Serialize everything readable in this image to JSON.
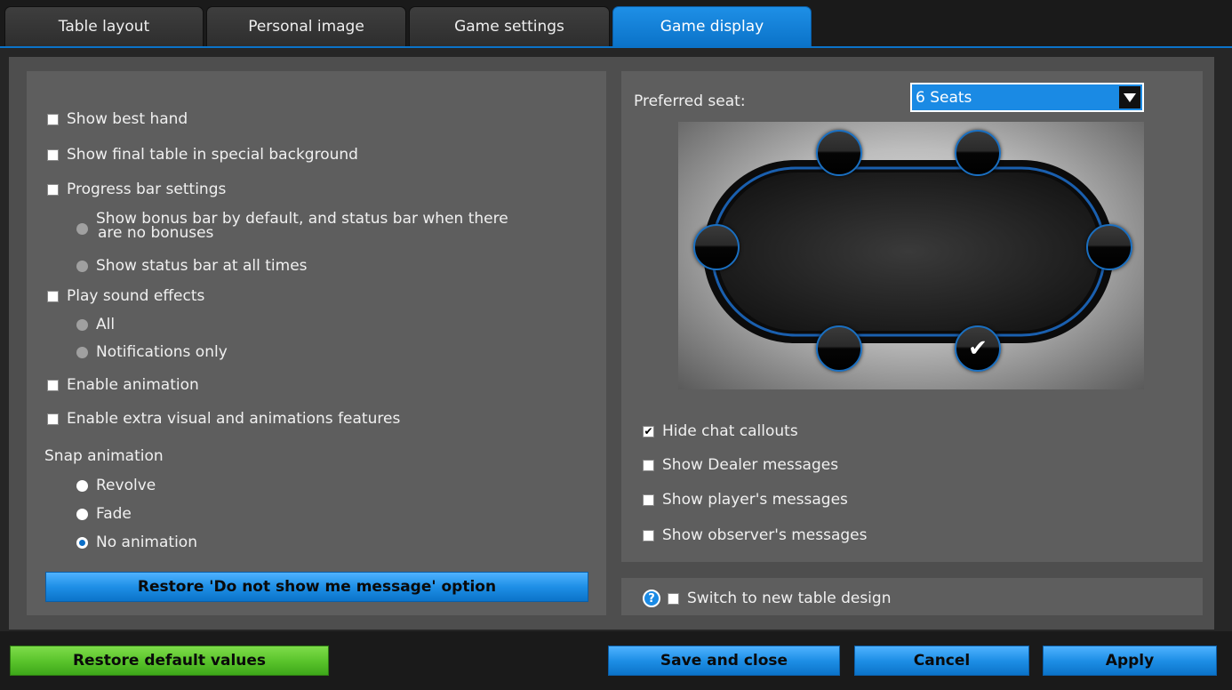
{
  "tabs": [
    {
      "label": "Table layout",
      "active": false
    },
    {
      "label": "Personal image",
      "active": false
    },
    {
      "label": "Game settings",
      "active": false
    },
    {
      "label": "Game display",
      "active": true
    }
  ],
  "left": {
    "show_best_hand": {
      "label": "Show best hand",
      "checked": false
    },
    "show_final_table": {
      "label": "Show final table in special background",
      "checked": false
    },
    "progress_bar": {
      "label": "Progress bar settings",
      "checked": false,
      "option_bonus_line1": "Show bonus bar by default, and status bar when there",
      "option_bonus_line2": "are no bonuses",
      "option_status": "Show status bar at all times"
    },
    "sound": {
      "label": "Play sound effects",
      "checked": false,
      "option_all": "All",
      "option_notifications": "Notifications only"
    },
    "enable_animation": {
      "label": "Enable animation",
      "checked": false
    },
    "extra_visual": {
      "label": "Enable extra visual and animations features",
      "checked": false
    },
    "snap": {
      "title": "Snap animation",
      "options": [
        "Revolve",
        "Fade",
        "No animation"
      ],
      "selected": "No animation"
    },
    "restore_message_button": "Restore 'Do not show me message' option"
  },
  "right": {
    "preferred_seat_label": "Preferred seat:",
    "seat_select_value": "6 Seats",
    "selected_seat": 5,
    "hide_chat": {
      "label": "Hide chat callouts",
      "checked": true
    },
    "dealer_messages": {
      "label": "Show Dealer messages",
      "checked": false
    },
    "player_messages": {
      "label": "Show player's messages",
      "checked": false
    },
    "observer_messages": {
      "label": "Show observer's messages",
      "checked": false
    },
    "new_table_design": {
      "label": "Switch to new table design",
      "checked": false,
      "help": "?"
    }
  },
  "footer": {
    "restore_defaults": "Restore default values",
    "save_close": "Save and close",
    "cancel": "Cancel",
    "apply": "Apply"
  },
  "colors": {
    "accent_blue": "#1e8fe6",
    "green_button": "#58c22a",
    "panel": "#5e5e5e"
  }
}
